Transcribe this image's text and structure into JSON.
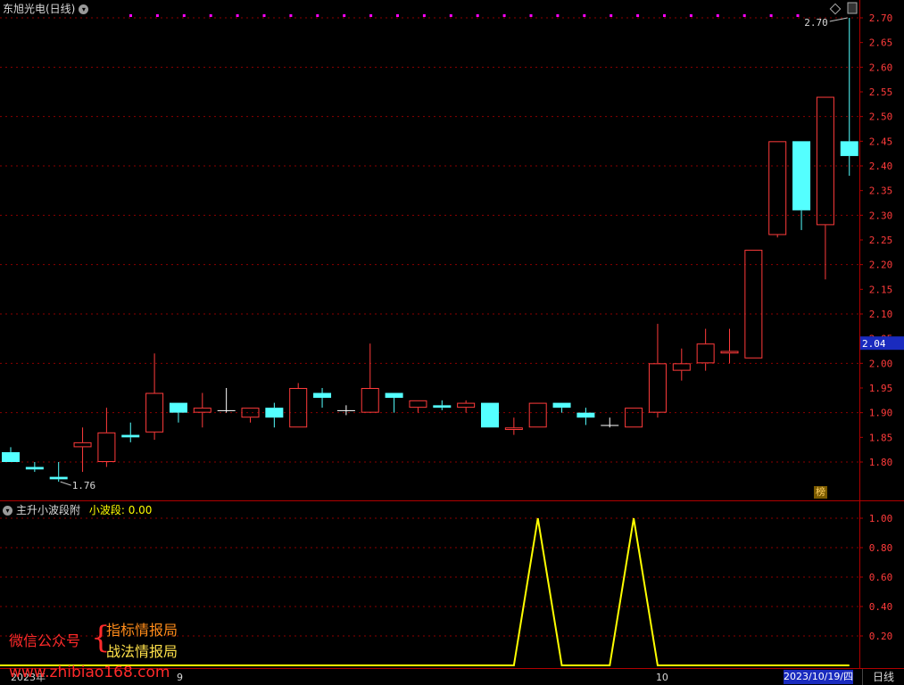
{
  "main_panel": {
    "title": "东旭光电(日线)",
    "last_price_label": "2.04",
    "high_annotation": "2.70",
    "low_annotation": "1.76",
    "rank_badge": "榜"
  },
  "indicator_panel": {
    "title": "主升小波段附",
    "series_label": "小波段: 0.00"
  },
  "footer": {
    "date_label": "2023/10/19/四",
    "period_button": "日线",
    "x_tick_labels": [
      "2023年",
      "9",
      "10"
    ]
  },
  "watermark": {
    "account_label": "微信公众号",
    "line1": "指标情报局",
    "line2": "战法情报局",
    "site": "www.zhibiao168.com"
  },
  "colors": {
    "up": "#ff3b3b",
    "down": "#54ffff",
    "indicator": "#ffff00",
    "grid": "#8b0000",
    "marker": "#ff00ff",
    "last_price_bg": "#1a2bbf"
  },
  "chart_data": [
    {
      "type": "candlestick",
      "title": "东旭光电(日线)",
      "ylim": [
        1.73,
        2.72
      ],
      "y_ticks": [
        "2.70",
        "2.65",
        "2.60",
        "2.55",
        "2.50",
        "2.45",
        "2.40",
        "2.35",
        "2.30",
        "2.25",
        "2.20",
        "2.15",
        "2.10",
        "2.05",
        "2.00",
        "1.95",
        "1.90",
        "1.85",
        "1.80"
      ],
      "grid": true,
      "x_tick_labels": [
        {
          "label": "2023年",
          "index": 0
        },
        {
          "label": "9",
          "index": 7
        },
        {
          "label": "10",
          "index": 27
        }
      ],
      "candles": [
        {
          "o": 1.82,
          "h": 1.83,
          "l": 1.8,
          "c": 1.8
        },
        {
          "o": 1.79,
          "h": 1.8,
          "l": 1.78,
          "c": 1.785
        },
        {
          "o": 1.77,
          "h": 1.8,
          "l": 1.76,
          "c": 1.765
        },
        {
          "o": 1.83,
          "h": 1.87,
          "l": 1.78,
          "c": 1.84
        },
        {
          "o": 1.8,
          "h": 1.91,
          "l": 1.79,
          "c": 1.86
        },
        {
          "o": 1.855,
          "h": 1.88,
          "l": 1.84,
          "c": 1.85
        },
        {
          "o": 1.86,
          "h": 2.02,
          "l": 1.845,
          "c": 1.94
        },
        {
          "o": 1.92,
          "h": 1.92,
          "l": 1.88,
          "c": 1.9
        },
        {
          "o": 1.9,
          "h": 1.94,
          "l": 1.87,
          "c": 1.91
        },
        {
          "o": 1.905,
          "h": 1.95,
          "l": 1.9,
          "c": 1.905
        },
        {
          "o": 1.89,
          "h": 1.91,
          "l": 1.88,
          "c": 1.91
        },
        {
          "o": 1.91,
          "h": 1.92,
          "l": 1.87,
          "c": 1.89
        },
        {
          "o": 1.87,
          "h": 1.96,
          "l": 1.87,
          "c": 1.95
        },
        {
          "o": 1.94,
          "h": 1.95,
          "l": 1.91,
          "c": 1.93
        },
        {
          "o": 1.905,
          "h": 1.915,
          "l": 1.895,
          "c": 1.905
        },
        {
          "o": 1.9,
          "h": 2.04,
          "l": 1.9,
          "c": 1.95
        },
        {
          "o": 1.94,
          "h": 1.94,
          "l": 1.9,
          "c": 1.93
        },
        {
          "o": 1.91,
          "h": 1.925,
          "l": 1.9,
          "c": 1.925
        },
        {
          "o": 1.915,
          "h": 1.925,
          "l": 1.905,
          "c": 1.91
        },
        {
          "o": 1.91,
          "h": 1.925,
          "l": 1.9,
          "c": 1.92
        },
        {
          "o": 1.92,
          "h": 1.92,
          "l": 1.87,
          "c": 1.87
        },
        {
          "o": 1.865,
          "h": 1.89,
          "l": 1.855,
          "c": 1.87
        },
        {
          "o": 1.87,
          "h": 1.92,
          "l": 1.87,
          "c": 1.92
        },
        {
          "o": 1.92,
          "h": 1.92,
          "l": 1.9,
          "c": 1.91
        },
        {
          "o": 1.9,
          "h": 1.91,
          "l": 1.875,
          "c": 1.89
        },
        {
          "o": 1.875,
          "h": 1.89,
          "l": 1.87,
          "c": 1.875
        },
        {
          "o": 1.87,
          "h": 1.91,
          "l": 1.87,
          "c": 1.91
        },
        {
          "o": 1.9,
          "h": 2.08,
          "l": 1.89,
          "c": 2.0
        },
        {
          "o": 1.985,
          "h": 2.03,
          "l": 1.965,
          "c": 2.0
        },
        {
          "o": 2.0,
          "h": 2.07,
          "l": 1.985,
          "c": 2.04
        },
        {
          "o": 2.02,
          "h": 2.07,
          "l": 2.0,
          "c": 2.025
        },
        {
          "o": 2.01,
          "h": 2.23,
          "l": 2.01,
          "c": 2.23
        },
        {
          "o": 2.26,
          "h": 2.45,
          "l": 2.255,
          "c": 2.45
        },
        {
          "o": 2.45,
          "h": 2.45,
          "l": 2.27,
          "c": 2.31
        },
        {
          "o": 2.28,
          "h": 2.54,
          "l": 2.17,
          "c": 2.54
        },
        {
          "o": 2.45,
          "h": 2.7,
          "l": 2.38,
          "c": 2.42
        }
      ],
      "top_markers": 26
    },
    {
      "type": "line",
      "title": "主升小波段附",
      "series": [
        {
          "name": "小波段",
          "values": [
            0,
            0,
            0,
            0,
            0,
            0,
            0,
            0,
            0,
            0,
            0,
            0,
            0,
            0,
            0,
            0,
            0,
            0,
            0,
            0,
            0,
            0,
            1,
            0,
            0,
            0,
            1,
            0,
            0,
            0,
            0,
            0,
            0,
            0,
            0,
            0
          ]
        }
      ],
      "ylim": [
        0,
        1.05
      ],
      "y_ticks": [
        "1.00",
        "0.80",
        "0.60",
        "0.40",
        "0.20"
      ],
      "grid": true
    }
  ]
}
